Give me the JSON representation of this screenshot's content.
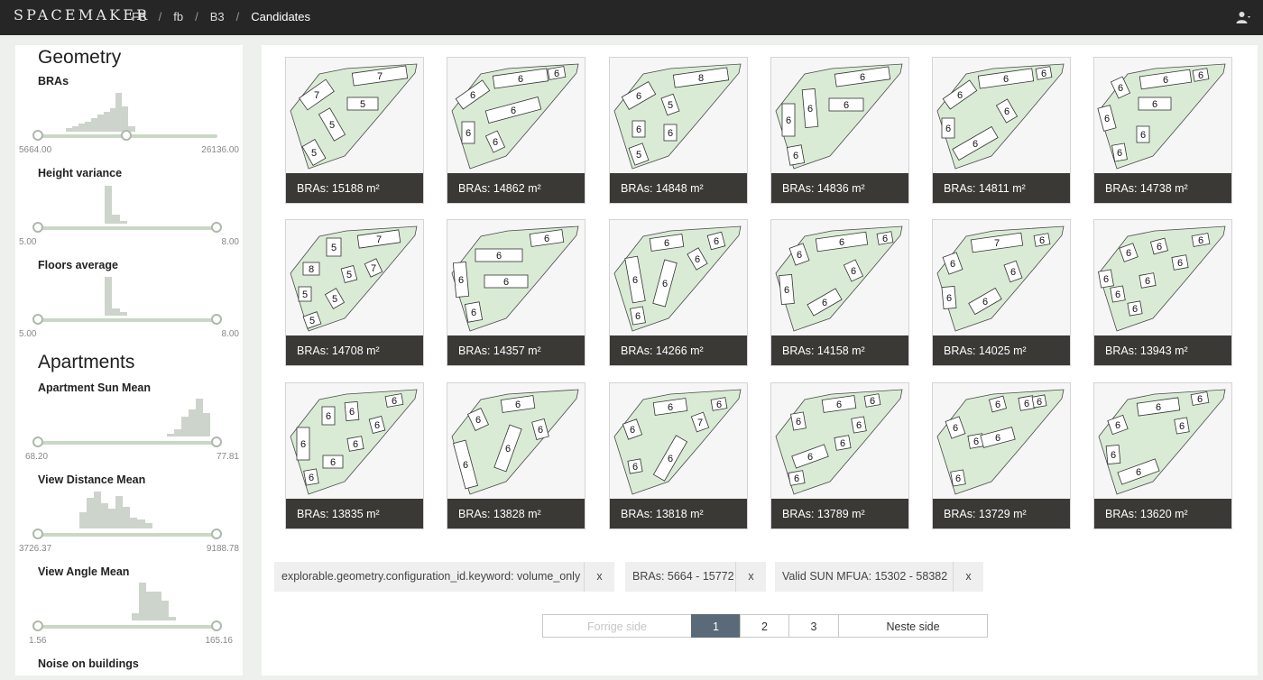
{
  "app": {
    "logo": "SPACEMAKER",
    "breadcrumbs": [
      "FB",
      "fb",
      "B3",
      "Candidates"
    ]
  },
  "sidebar": {
    "sections": [
      "Geometry",
      "Apartments"
    ],
    "filters": [
      {
        "label": "BRAs",
        "min": "5664.00",
        "max": "26136.00"
      },
      {
        "label": "Height variance",
        "min": "5.00",
        "max": "8.00"
      },
      {
        "label": "Floors average",
        "min": "5.00",
        "max": "8.00"
      },
      {
        "label": "Apartment Sun Mean",
        "min": "68.20",
        "max": "77.81"
      },
      {
        "label": "View Distance Mean",
        "min": "3726.37",
        "max": "9188.78"
      },
      {
        "label": "View Angle Mean",
        "min": "1.56",
        "max": "165.16"
      },
      {
        "label": "Noise on buildings"
      }
    ]
  },
  "candidates": [
    {
      "label": "BRAs: 15188 m²",
      "floors": [
        "7",
        "7",
        "5",
        "5",
        "5"
      ]
    },
    {
      "label": "BRAs: 14862 m²",
      "floors": [
        "6",
        "6",
        "6",
        "6",
        "6",
        "6"
      ]
    },
    {
      "label": "BRAs: 14848 m²",
      "floors": [
        "6",
        "8",
        "5",
        "6",
        "6",
        "5"
      ]
    },
    {
      "label": "BRAs: 14836 m²",
      "floors": [
        "6",
        "6",
        "6",
        "6",
        "6"
      ]
    },
    {
      "label": "BRAs: 14811 m²",
      "floors": [
        "6",
        "6",
        "6",
        "6",
        "6",
        "6"
      ]
    },
    {
      "label": "BRAs: 14738 m²",
      "floors": [
        "6",
        "6",
        "6",
        "6",
        "6",
        "6",
        "6"
      ]
    },
    {
      "label": "BRAs: 14708 m²",
      "floors": [
        "5",
        "7",
        "8",
        "5",
        "7",
        "5",
        "5",
        "5"
      ]
    },
    {
      "label": "BRAs: 14357 m²",
      "floors": [
        "6",
        "6",
        "6",
        "6",
        "6"
      ]
    },
    {
      "label": "BRAs: 14266 m²",
      "floors": [
        "6",
        "6",
        "6",
        "6",
        "6",
        "6"
      ]
    },
    {
      "label": "BRAs: 14158 m²",
      "floors": [
        "6",
        "6",
        "6",
        "6",
        "6",
        "6"
      ]
    },
    {
      "label": "BRAs: 14025 m²",
      "floors": [
        "6",
        "7",
        "6",
        "6",
        "6",
        "6"
      ]
    },
    {
      "label": "BRAs: 13943 m²",
      "floors": [
        "6",
        "6",
        "6",
        "6",
        "6",
        "6",
        "6",
        "6"
      ]
    },
    {
      "label": "BRAs: 13835 m²",
      "floors": [
        "6",
        "6",
        "6",
        "6",
        "6",
        "6",
        "6",
        "6"
      ]
    },
    {
      "label": "BRAs: 13828 m²",
      "floors": [
        "6",
        "6",
        "6",
        "6",
        "6"
      ]
    },
    {
      "label": "BRAs: 13818 m²",
      "floors": [
        "6",
        "6",
        "6",
        "7",
        "6",
        "6"
      ]
    },
    {
      "label": "BRAs: 13789 m²",
      "floors": [
        "6",
        "6",
        "6",
        "6",
        "6",
        "6",
        "6"
      ]
    },
    {
      "label": "BRAs: 13729 m²",
      "floors": [
        "6",
        "6",
        "6",
        "6",
        "6",
        "6",
        "6"
      ]
    },
    {
      "label": "BRAs: 13620 m²",
      "floors": [
        "6",
        "6",
        "6",
        "6",
        "6",
        "6"
      ]
    }
  ],
  "active_filters": [
    {
      "text": "explorable.geometry.configuration_id.keyword: volume_only",
      "remove": "x"
    },
    {
      "text": "BRAs: 5664 - 15772",
      "remove": "x"
    },
    {
      "text": "Valid SUN MFUA: 15302 - 58382",
      "remove": "x"
    }
  ],
  "pagination": {
    "prev": "Forrige side",
    "pages": [
      "1",
      "2",
      "3"
    ],
    "current": "1",
    "next": "Neste side"
  },
  "colors": {
    "topbar": "#262626",
    "site_fill": "#d9ebd5",
    "card_label_bg": "#3a3936",
    "pager_active": "#5a6a78"
  },
  "icons": {
    "user": "user-icon"
  }
}
